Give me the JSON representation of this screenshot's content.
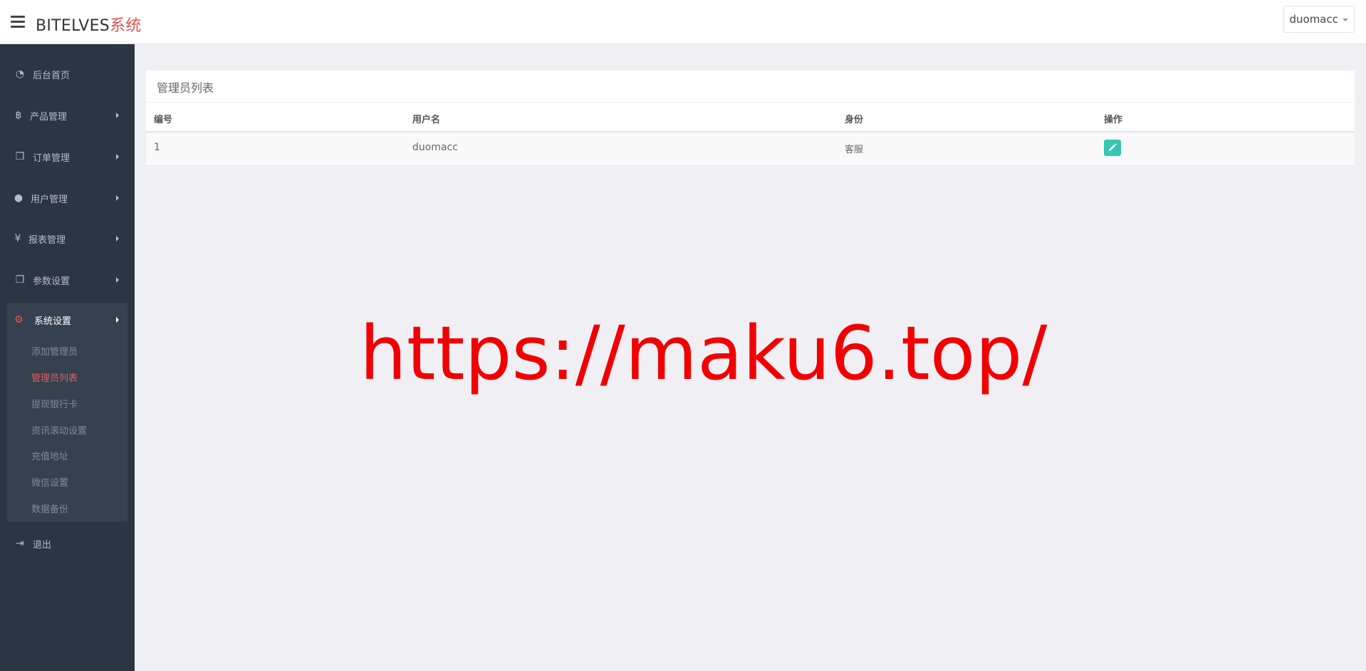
{
  "header": {
    "brand_main": "BITELVES",
    "brand_accent": "系统",
    "user_name": "duomacc"
  },
  "sidebar": {
    "items": [
      {
        "label": "后台首页",
        "icon": "dashboard-icon"
      },
      {
        "label": "产品管理",
        "icon": "bitcoin-icon"
      },
      {
        "label": "订单管理",
        "icon": "copy-icon"
      },
      {
        "label": "用户管理",
        "icon": "user-icon"
      },
      {
        "label": "报表管理",
        "icon": "yen-icon"
      },
      {
        "label": "参数设置",
        "icon": "copy-icon"
      }
    ],
    "group": {
      "label": "系统设置",
      "icon": "cogs-icon",
      "children": [
        "添加管理员",
        "管理员列表",
        "提现银行卡",
        "资讯滚动设置",
        "充值地址",
        "微信设置",
        "数据备份"
      ],
      "active_index": 1
    },
    "logout": {
      "label": "退出",
      "icon": "sign-out-icon"
    }
  },
  "main": {
    "panel_title": "管理员列表",
    "columns": [
      "编号",
      "用户名",
      "身份",
      "操作"
    ],
    "rows": [
      {
        "id": "1",
        "username": "duomacc",
        "role": "客服"
      }
    ]
  },
  "watermark": "https://maku6.top/",
  "colors": {
    "sidebar_bg": "#2b3643",
    "accent": "#e35b5a",
    "edit_button": "#36c6b3",
    "watermark": "#f00000"
  }
}
